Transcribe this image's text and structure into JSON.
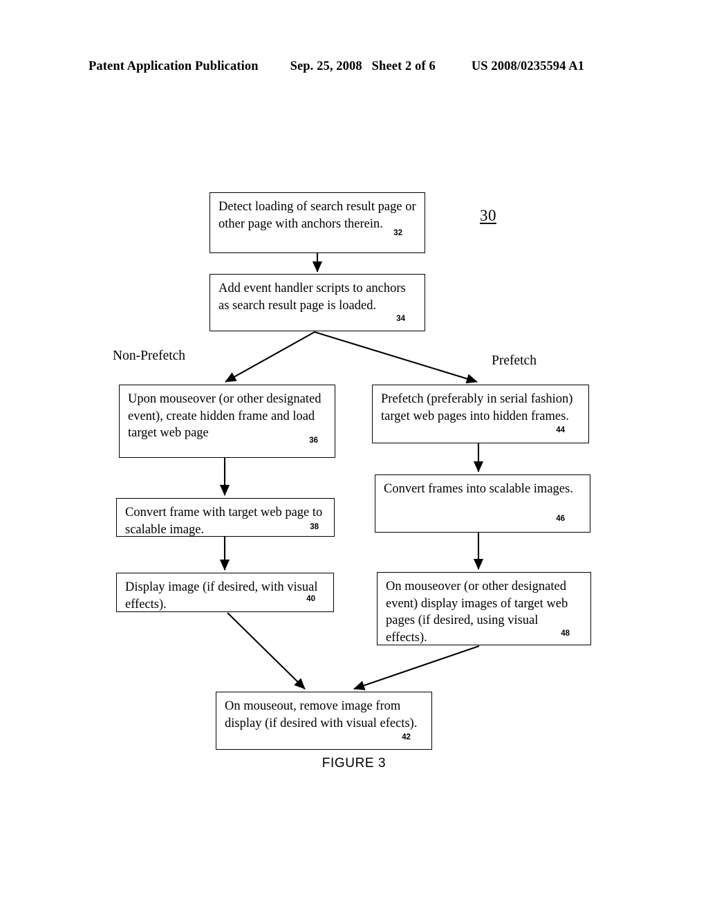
{
  "header": {
    "publication": "Patent Application Publication",
    "date": "Sep. 25, 2008",
    "sheet": "Sheet 2 of 6",
    "patent_number": "US 2008/0235594 A1"
  },
  "figure": {
    "caption": "FIGURE 3",
    "diagram_ref": "30"
  },
  "branches": {
    "left_label": "Non-Prefetch",
    "right_label": "Prefetch"
  },
  "boxes": {
    "b32": {
      "text": "Detect loading of search result page or other page with anchors therein.",
      "ref": "32"
    },
    "b34": {
      "text": "Add event handler scripts to anchors as search result page is loaded.",
      "ref": "34"
    },
    "b36": {
      "text": "Upon mouseover (or other designated event), create hidden frame and load target web page",
      "ref": "36"
    },
    "b44": {
      "text": "Prefetch (preferably in serial fashion) target web pages into hidden frames.",
      "ref": "44"
    },
    "b38": {
      "text": "Convert frame with target web page to scalable image.",
      "ref": "38"
    },
    "b46": {
      "text": "Convert frames into scalable images.",
      "ref": "46"
    },
    "b40": {
      "text": "Display image (if desired, with visual effects).",
      "ref": "40"
    },
    "b48": {
      "text": "On mouseover (or other designated event) display images of target web pages (if desired, using visual effects).",
      "ref": "48"
    },
    "b42": {
      "text": "On mouseout, remove image from display (if desired with visual efects).",
      "ref": "42"
    }
  }
}
